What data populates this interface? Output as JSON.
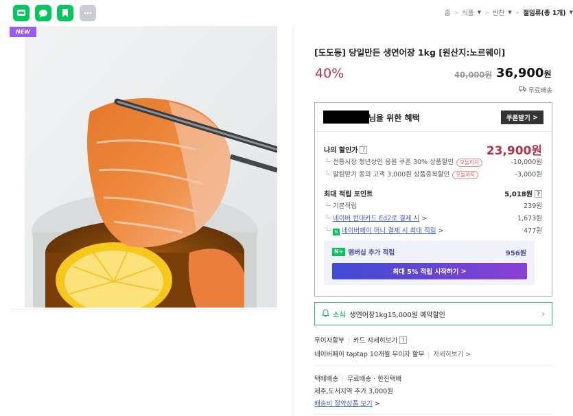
{
  "topbar": {
    "icons": [
      "talk-icon",
      "talktalk-icon",
      "bookmark-icon",
      "more-icon"
    ],
    "breadcrumb": [
      "홈",
      "식품",
      "반찬",
      "절임류(총 1개)"
    ]
  },
  "product": {
    "badge": "NEW",
    "title": "[도도동] 당일만든 생연어장 1kg [원산지:노르웨이]",
    "discount_rate": "40%",
    "original_price": "40,000원",
    "sale_price": "36,900",
    "sale_unit": "원",
    "shipping": "무료배송"
  },
  "benefit": {
    "title": "님을 위한 혜택",
    "coupon_button": "쿠폰받기",
    "my_price_label": "나의 할인가",
    "my_price": "23,900원",
    "discounts": [
      {
        "label": "전통시장 청년상인 응원 쿠폰 30% 상품할인",
        "pill": "오늘까지",
        "value": "-10,000원"
      },
      {
        "label": "알림받기 동의 고객 3,000원 상품중복할인",
        "pill": "오늘까지",
        "value": "-3,000원"
      }
    ],
    "points_label": "최대 적립 포인트",
    "points_value": "5,018원",
    "points": [
      {
        "label": "기본적립",
        "value": "239원"
      },
      {
        "label": "네이버 현대카드 Ed2로 결제 시",
        "value": "1,673원"
      },
      {
        "label": "네이버페이 머니 결제 시 최대 적립",
        "value": "477원"
      }
    ],
    "member_label": "멤버십 추가 적립",
    "member_value": "956원",
    "start_button": "최대 5% 적립 시작하기"
  },
  "news": {
    "tag": "소식",
    "text": "생연어장1kg15,000원 예약할인"
  },
  "payment": {
    "installment": "무이자할부",
    "card_detail": "카드 자세히보기",
    "taptap": "네이버페이 taptap 10개월 무이자 할부",
    "taptap_detail": "자세히보기"
  },
  "delivery": {
    "type": "택배배송",
    "info": "무료배송 · 한진택배",
    "extra": "제주,도서지역 추가 3,000원",
    "save_link": "배송비 절약상품 보기"
  },
  "colors": {
    "naver_green": "#03c75a",
    "discount_red": "#b3334a",
    "badge_purple": "#9b5cf5",
    "link_blue": "#3b5bdb"
  }
}
